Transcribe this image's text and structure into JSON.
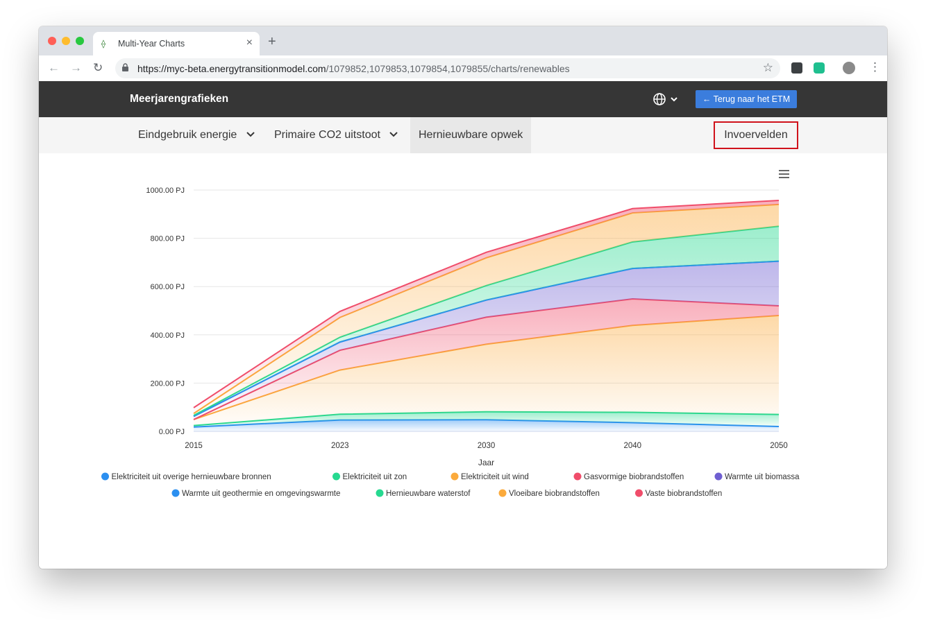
{
  "browser": {
    "tab_title": "Multi-Year Charts",
    "tab_favicon": "etm-favicon-icon",
    "url_host": "https://myc-beta.energytransitionmodel.com",
    "url_path": "/1079852,1079853,1079854,1079855/charts/renewables"
  },
  "app": {
    "brand": "Meerjarengrafieken",
    "back_button": "← Terug naar het ETM"
  },
  "nav": {
    "tabs": [
      {
        "label": "Eindgebruik energie"
      },
      {
        "label": "Primaire CO2 uitstoot"
      },
      {
        "label": "Hernieuwbare opwek"
      }
    ],
    "active_tab": "Hernieuwbare opwek",
    "input_fields_button": "Invoervelden"
  },
  "chart_data": {
    "type": "area",
    "stacked": true,
    "x": [
      "2015",
      "2023",
      "2030",
      "2040",
      "2050"
    ],
    "xlabel": "Jaar",
    "ylabel": "",
    "y_ticks": [
      "0.00 PJ",
      "200.00 PJ",
      "400.00 PJ",
      "600.00 PJ",
      "800.00 PJ",
      "1000.00 PJ"
    ],
    "ylim": [
      0,
      1000
    ],
    "unit": "PJ",
    "legend_position": "bottom",
    "series_cumulative_note_removed": true,
    "series": [
      {
        "name": "Elektriciteit uit overige hernieuwbare bronnen",
        "color": "#2b8ff0",
        "values": [
          18,
          47,
          48,
          36,
          20
        ]
      },
      {
        "name": "Elektriciteit uit zon",
        "color": "#26d990",
        "values": [
          6,
          24,
          33,
          43,
          50
        ]
      },
      {
        "name": "Elektriciteit uit wind",
        "color": "#fbaa3c",
        "values": [
          25,
          183,
          280,
          360,
          410
        ]
      },
      {
        "name": "Gasvormige biobrandstoffen",
        "color": "#f04d6a",
        "values": [
          0,
          82,
          112,
          110,
          40
        ]
      },
      {
        "name": "Warmte uit biomassa",
        "color": "#6f5fd1",
        "values": [
          13,
          34,
          71,
          126,
          185
        ]
      },
      {
        "name": "Warmte uit geothermie en omgevingswarmte",
        "color": "#2b8ff0",
        "values": [
          0,
          0,
          0,
          0,
          0
        ]
      },
      {
        "name": "Hernieuwbare waterstof",
        "color": "#26d990",
        "values": [
          4,
          20,
          60,
          110,
          145
        ]
      },
      {
        "name": "Vloeibare biobrandstoffen",
        "color": "#fbaa3c",
        "values": [
          8,
          82,
          115,
          120,
          90
        ]
      },
      {
        "name": "Vaste biobrandstoffen",
        "color": "#f04d6a",
        "values": [
          24,
          25,
          23,
          18,
          17
        ]
      }
    ]
  }
}
